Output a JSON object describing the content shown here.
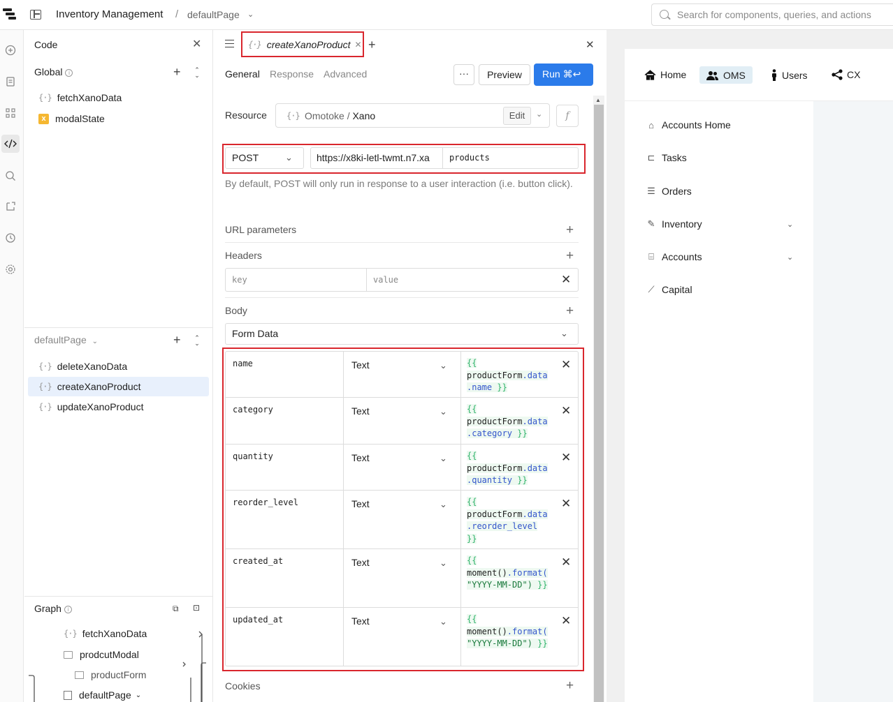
{
  "topbar": {
    "app_title": "Inventory Management",
    "separator": "/",
    "page_name": "defaultPage",
    "search_placeholder": "Search for components, queries, and actions"
  },
  "code_panel": {
    "title": "Code",
    "global_label": "Global",
    "global_items": [
      "fetchXanoData",
      "modalState"
    ],
    "page_label": "defaultPage",
    "page_items": [
      "deleteXanoData",
      "createXanoProduct",
      "updateXanoProduct"
    ],
    "selected_item": "createXanoProduct",
    "graph_label": "Graph",
    "graph_items": [
      "fetchXanoData",
      "prodcutModal",
      "productForm",
      "defaultPage"
    ]
  },
  "editor": {
    "tab_name": "createXanoProduct",
    "subtabs": [
      "General",
      "Response",
      "Advanced"
    ],
    "active_subtab": "General",
    "more_label": "···",
    "preview_label": "Preview",
    "run_label": "Run ⌘↩",
    "resource_label": "Resource",
    "resource_owner": "Omotoke / ",
    "resource_name": "Xano",
    "edit_label": "Edit",
    "fx_label": "f",
    "method": "POST",
    "url_base": "https://x8ki-letl-twmt.n7.xa",
    "url_path": "products",
    "helper_text": "By default, POST will only run in response to a user interaction (i.e. button click).",
    "url_params_label": "URL parameters",
    "headers_label": "Headers",
    "header_key_placeholder": "key",
    "header_value_placeholder": "value",
    "body_label": "Body",
    "body_type": "Form Data",
    "body_rows": [
      {
        "key": "name",
        "type": "Text",
        "l1": "{{",
        "l2a": "productForm",
        "l2b": ".data",
        "l3": ".name",
        "l3b": " }}",
        "l4": ""
      },
      {
        "key": "category",
        "type": "Text",
        "l1": "{{",
        "l2a": "productForm",
        "l2b": ".data",
        "l3": ".category",
        "l3b": " }}",
        "l4": ""
      },
      {
        "key": "quantity",
        "type": "Text",
        "l1": "{{",
        "l2a": "productForm",
        "l2b": ".data",
        "l3": ".quantity",
        "l3b": " }}",
        "l4": ""
      },
      {
        "key": "reorder_level",
        "type": "Text",
        "l1": "{{",
        "l2a": "productForm",
        "l2b": ".data",
        "l3": ".reorder_level",
        "l3b": "",
        "l4": "}}"
      },
      {
        "key": "created_at",
        "type": "Text",
        "l1": "{{",
        "l2a": "moment()",
        "l2b": ".format(",
        "l3": "\"YYYY-MM-DD\")",
        "l3b": " }}",
        "l4": ""
      },
      {
        "key": "updated_at",
        "type": "Text",
        "l1": "{{",
        "l2a": "moment()",
        "l2b": ".format(",
        "l3": "\"YYYY-MM-DD\")",
        "l3b": " }}",
        "l4": ""
      }
    ],
    "cookies_label": "Cookies"
  },
  "preview": {
    "top_nav": [
      "Home",
      "OMS",
      "Users",
      "CX"
    ],
    "active_top": "OMS",
    "side_nav": [
      "Accounts Home",
      "Tasks",
      "Orders",
      "Inventory",
      "Accounts",
      "Capital"
    ]
  },
  "colors": {
    "accent": "#2b7bea",
    "highlight_border": "#d9262d",
    "selected_bg": "#e8f0fc",
    "oms_active_bg": "#e1eef5"
  }
}
